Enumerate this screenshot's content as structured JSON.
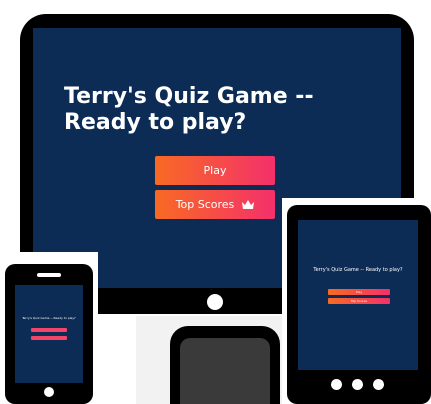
{
  "desktop": {
    "title": "Terry's Quiz Game -- Ready to play?",
    "play_label": "Play",
    "top_scores_label": "Top Scores"
  },
  "tablet": {
    "title": "Terry's Quiz Game -- Ready to play?",
    "play_label": "Play",
    "top_scores_label": "Top Scores"
  },
  "phone": {
    "title": "Terry's Quiz Game -- Ready to play?"
  },
  "colors": {
    "screen_bg": "#0c2c55",
    "button_gradient_start": "#f86a23",
    "button_gradient_end": "#f4306b"
  }
}
